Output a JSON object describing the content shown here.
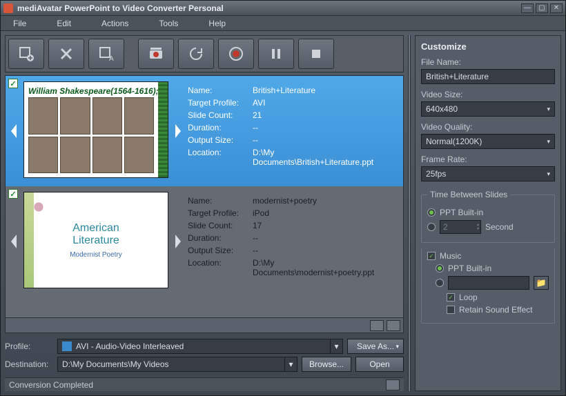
{
  "title": "mediAvatar PowerPoint to Video Converter Personal",
  "menu": [
    "File",
    "Edit",
    "Actions",
    "Tools",
    "Help"
  ],
  "items": [
    {
      "thumb_title": "William Shakespeare(1564-1616);",
      "name": "British+Literature",
      "profile": "AVI",
      "slides": "21",
      "duration": "--",
      "output": "--",
      "loc": "D:\\My Documents\\British+Literature.ppt"
    },
    {
      "thumb_title1": "American",
      "thumb_title2": "Literature",
      "thumb_sub": "Modernist Poetry",
      "name": "modernist+poetry",
      "profile": "iPod",
      "slides": "17",
      "duration": "--",
      "output": "--",
      "loc": "D:\\My Documents\\modernist+poetry.ppt"
    }
  ],
  "labels": {
    "name": "Name:",
    "profile": "Target Profile:",
    "slides": "Slide Count:",
    "duration": "Duration:",
    "output": "Output Size:",
    "loc": "Location:"
  },
  "profile": {
    "label": "Profile:",
    "value": "AVI - Audio-Video Interleaved",
    "save": "Save As..."
  },
  "dest": {
    "label": "Destination:",
    "value": "D:\\My Documents\\My Videos",
    "browse": "Browse...",
    "open": "Open"
  },
  "status": "Conversion Completed",
  "customize": {
    "title": "Customize",
    "filename": {
      "label": "File Name:",
      "value": "British+Literature"
    },
    "size": {
      "label": "Video Size:",
      "value": "640x480"
    },
    "quality": {
      "label": "Video Quality:",
      "value": "Normal(1200K)"
    },
    "fps": {
      "label": "Frame Rate:",
      "value": "25fps"
    },
    "tbs": {
      "legend": "Time Between Slides",
      "builtin": "PPT Built-in",
      "val": "2",
      "unit": "Second"
    },
    "music": {
      "label": "Music",
      "builtin": "PPT Built-in",
      "loop": "Loop",
      "retain": "Retain Sound Effect"
    }
  }
}
